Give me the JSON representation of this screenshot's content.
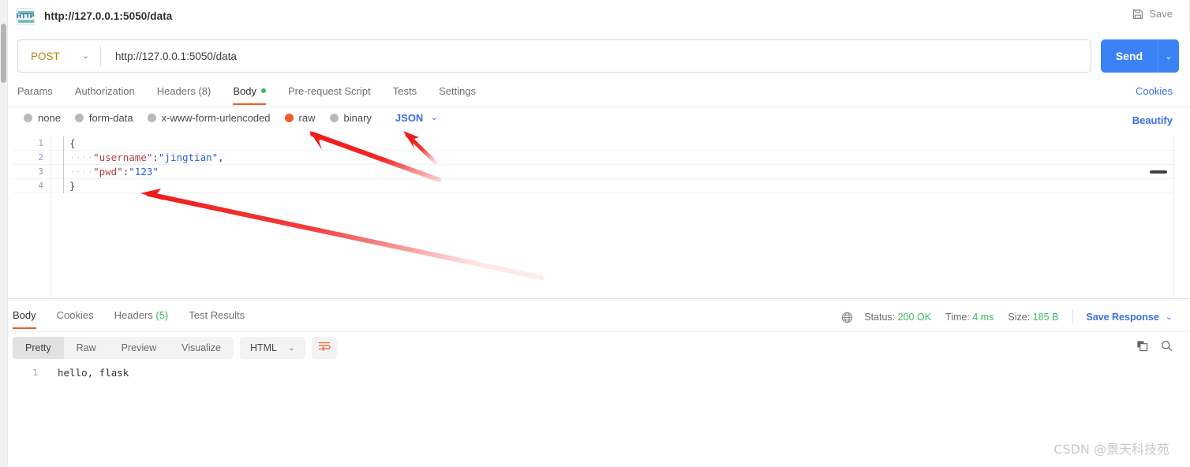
{
  "window": {
    "tab_title": "http://127.0.0.1:5050/data",
    "tab_icon": "http-protocol-icon",
    "save_label": "Save"
  },
  "request": {
    "method": "POST",
    "url": "http://127.0.0.1:5050/data",
    "send_label": "Send",
    "tabs": [
      {
        "label": "Params",
        "active": false
      },
      {
        "label": "Authorization",
        "active": false
      },
      {
        "label": "Headers (8)",
        "active": false
      },
      {
        "label": "Body",
        "active": true,
        "dot": true
      },
      {
        "label": "Pre-request Script",
        "active": false
      },
      {
        "label": "Tests",
        "active": false
      },
      {
        "label": "Settings",
        "active": false
      }
    ],
    "cookies_link": "Cookies",
    "beautify_link": "Beautify",
    "body_types": [
      {
        "label": "none",
        "selected": false
      },
      {
        "label": "form-data",
        "selected": false
      },
      {
        "label": "x-www-form-urlencoded",
        "selected": false
      },
      {
        "label": "raw",
        "selected": true
      },
      {
        "label": "binary",
        "selected": false
      }
    ],
    "raw_format": "JSON",
    "editor_lines": [
      {
        "n": "1",
        "indent": "",
        "key": "",
        "colon": "",
        "value": "",
        "brace": "{"
      },
      {
        "n": "2",
        "indent": "····",
        "key": "\"username\"",
        "colon": ":",
        "value": "\"jingtian\"",
        "comma": ","
      },
      {
        "n": "3",
        "indent": "····",
        "key": "\"pwd\"",
        "colon": ":",
        "value": "\"123\"",
        "comma": ""
      },
      {
        "n": "4",
        "indent": "",
        "key": "",
        "colon": "",
        "value": "",
        "brace": "}"
      }
    ]
  },
  "response": {
    "tabs": [
      {
        "label": "Body",
        "active": true
      },
      {
        "label": "Cookies",
        "active": false
      },
      {
        "label": "Headers",
        "count": "(5)",
        "active": false
      },
      {
        "label": "Test Results",
        "active": false
      }
    ],
    "meta": {
      "status_label": "Status:",
      "status_value": "200 OK",
      "time_label": "Time:",
      "time_value": "4 ms",
      "size_label": "Size:",
      "size_value": "185 B",
      "save_response": "Save Response"
    },
    "view_modes": [
      {
        "label": "Pretty",
        "active": true
      },
      {
        "label": "Raw",
        "active": false
      },
      {
        "label": "Preview",
        "active": false
      },
      {
        "label": "Visualize",
        "active": false
      }
    ],
    "format": "HTML",
    "body_lines": [
      {
        "n": "1",
        "text": "hello, flask"
      }
    ]
  },
  "watermark": "CSDN @景天科技苑",
  "colors": {
    "accent_orange": "#ef5b25",
    "send_blue": "#3b82f6",
    "link_blue": "#3b6fe0",
    "method_gold": "#b8860b",
    "status_green": "#3dbb5f",
    "annotation_red": "#f01b1b"
  }
}
